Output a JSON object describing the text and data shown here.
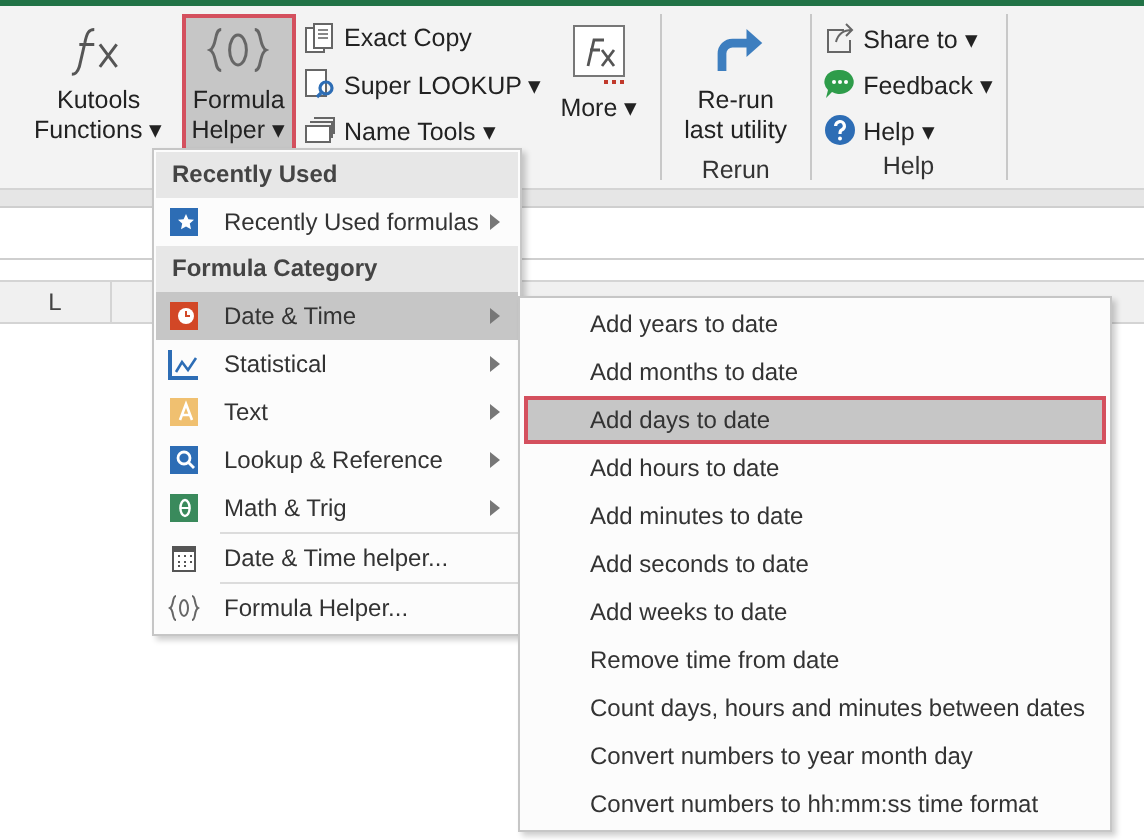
{
  "ribbon": {
    "groups": [
      {
        "large_buttons": [
          {
            "kind": "fx",
            "lines": [
              "Kutools",
              "Functions"
            ],
            "dropdown": "▾",
            "selected": false
          },
          {
            "kind": "braces",
            "lines": [
              "Formula",
              "Helper"
            ],
            "dropdown": "▾",
            "selected": true
          }
        ],
        "small_buttons": [
          {
            "kind": "copy",
            "label": "Exact Copy"
          },
          {
            "kind": "lookup",
            "label": "Super LOOKUP",
            "dropdown": "▾"
          },
          {
            "kind": "names",
            "label": "Name Tools",
            "dropdown": "▾"
          }
        ],
        "after": [
          {
            "kind": "fxbox",
            "lines": [
              "More"
            ],
            "dropdown": "▾",
            "selected": false
          }
        ]
      },
      {
        "label": "Rerun",
        "large_buttons": [
          {
            "kind": "rerun",
            "lines": [
              "Re-run",
              "last utility"
            ],
            "selected": false
          }
        ]
      },
      {
        "label": "Help",
        "small_buttons": [
          {
            "kind": "share",
            "label": "Share to",
            "dropdown": "▾"
          },
          {
            "kind": "feedback",
            "label": "Feedback",
            "dropdown": "▾"
          },
          {
            "kind": "help",
            "label": "Help",
            "dropdown": "▾"
          }
        ]
      }
    ]
  },
  "sheet": {
    "column_headers": [
      "L"
    ]
  },
  "menu": {
    "items": [
      {
        "kind": "header",
        "label": "Recently Used"
      },
      {
        "kind": "submenu",
        "label": "Recently Used formulas",
        "selected": false
      },
      {
        "kind": "header",
        "label": "Formula Category"
      },
      {
        "kind": "submenu",
        "label": "Date & Time",
        "selected": true
      },
      {
        "kind": "submenu",
        "label": "Statistical",
        "selected": false
      },
      {
        "kind": "submenu",
        "label": "Text",
        "selected": false
      },
      {
        "kind": "submenu",
        "label": "Lookup & Reference",
        "selected": false
      },
      {
        "kind": "submenu",
        "label": "Math & Trig",
        "selected": false
      },
      {
        "kind": "command",
        "label": "Date & Time helper...",
        "selected": false
      },
      {
        "kind": "command",
        "label": "Formula Helper...",
        "selected": false
      }
    ]
  },
  "submenu": {
    "items": [
      {
        "label": "Add years to date",
        "selected": false
      },
      {
        "label": "Add months to date",
        "selected": false
      },
      {
        "label": "Add days to date",
        "selected": true
      },
      {
        "label": "Add hours to date",
        "selected": false
      },
      {
        "label": "Add minutes to date",
        "selected": false
      },
      {
        "label": "Add seconds to date",
        "selected": false
      },
      {
        "label": "Add weeks to date",
        "selected": false
      },
      {
        "label": "Remove time from date",
        "selected": false
      },
      {
        "label": "Count days, hours and minutes between dates",
        "selected": false
      },
      {
        "label": "Convert numbers to year month day",
        "selected": false
      },
      {
        "label": "Convert numbers to hh:mm:ss time format",
        "selected": false
      }
    ]
  }
}
